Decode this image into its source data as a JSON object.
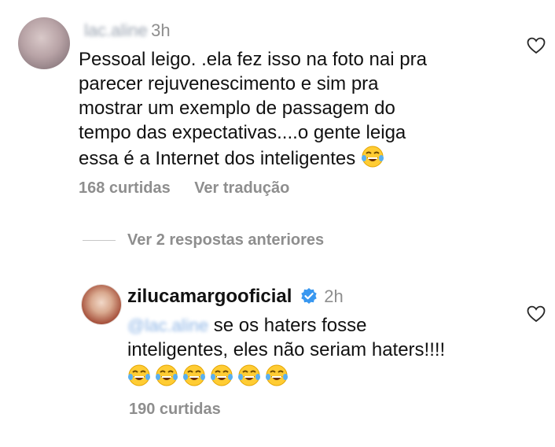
{
  "comment1": {
    "username": "lac.aline",
    "time": "3h",
    "lines": [
      "Pessoal leigo. .ela fez isso na foto nai pra",
      "parecer rejuvenescimento e sim pra",
      "mostrar um exemplo de passagem do",
      "tempo das expectativas....o gente leiga",
      "essa é a Internet dos inteligentes"
    ],
    "likes": "168 curtidas",
    "translate": "Ver tradução",
    "icons": {
      "emoji": "face-with-tears-of-joy-icon",
      "like": "heart-outline-icon"
    }
  },
  "replies": {
    "toggle": "Ver 2 respostas anteriores"
  },
  "comment2": {
    "username": "zilucamargooficial",
    "time": "2h",
    "mention": "@lac.aline",
    "line1": "se os haters fosse",
    "line2": "inteligentes, eles não seriam haters!!!!",
    "emoji_count": 6,
    "likes": "190 curtidas",
    "icons": {
      "verified": "verified-badge-icon",
      "emoji": "face-with-tears-of-joy-icon",
      "like": "heart-outline-icon"
    }
  },
  "colors": {
    "text": "#111111",
    "muted": "#8e8e8e",
    "verified": "#3897f0",
    "divider": "#c7c7c7"
  }
}
